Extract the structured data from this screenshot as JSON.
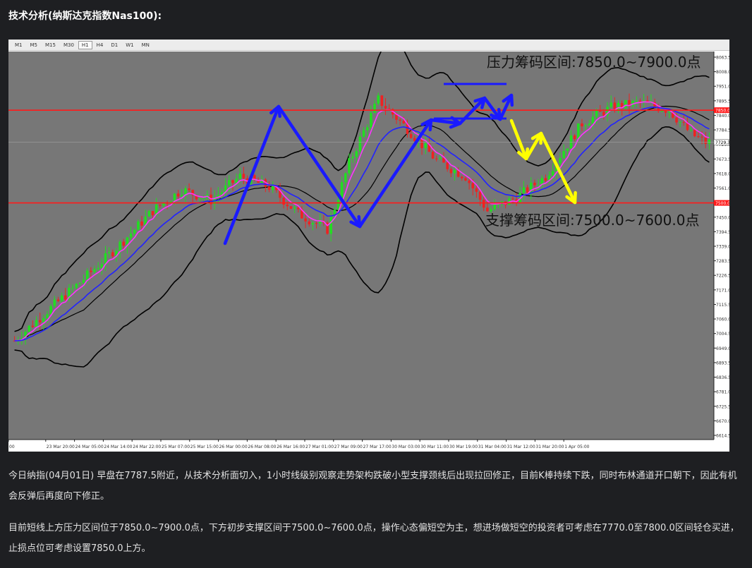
{
  "page": {
    "heading": "技术分析(纳斯达克指数Nas100):",
    "paragraphs": [
      "今日纳指(04月01日) 早盘在7787.5附近，从技术分析面切入，1小时线级别观察走势架构跌破小型支撑颈线后出现拉回修正，目前K棒持续下跌，同时布林通道开口朝下，因此有机会反弹后再度向下修正。",
      "目前短线上方压力区间位于7850.0~7900.0点，下方初步支撑区间于7500.0~7600.0点，操作心态偏短空为主，想进场做短空的投资者可考虑在7770.0至7800.0区间轻仓买进，止损点位可考虑设置7850.0上方。"
    ]
  },
  "toolbar": {
    "timeframes": [
      "M1",
      "M5",
      "M15",
      "M30",
      "H1",
      "H4",
      "D1",
      "W1",
      "MN"
    ],
    "active": "H1"
  },
  "colors": {
    "plot_bg": "#777777",
    "resistance_line": "#ff1a1a",
    "support_line": "#ff1a1a",
    "arrows_blue": "#1a1aff",
    "arrows_yellow": "#ffff00",
    "bull_candle": "#22dd22",
    "bear_candle": "#ee2222",
    "ma_fast": "#ff33ff",
    "ma_slow": "#2222ff",
    "bollinger": "#000000"
  },
  "chart_data": {
    "type": "candlestick",
    "symbol": "Nas100",
    "timeframe": "H1",
    "annotations": {
      "resistance_label": "压力筹码区间:7850.0~7900.0点",
      "support_label": "支撑筹码区间:7500.0~7600.0点"
    },
    "horizontal_lines": [
      {
        "value": 7850.0,
        "label": "7850.0"
      },
      {
        "value": 7500.0,
        "label": "7500.0"
      }
    ],
    "current_price": {
      "value": 7729.3,
      "label": "7729.3"
    },
    "ylim": [
      6614.5,
      8063.5
    ],
    "y_ticks": [
      "8063.5",
      "8008.0",
      "7951.0",
      "7895.5",
      "7840.0",
      "7784.5",
      "7729.0",
      "7673.5",
      "7618.0",
      "7561.0",
      "7505.5",
      "7450.0",
      "7394.5",
      "7339.0",
      "7283.5",
      "7226.5",
      "7171.0",
      "7115.5",
      "7060.0",
      "7004.5",
      "6949.0",
      "6893.5",
      "6836.5",
      "6781.0",
      "6725.5",
      "6670.0",
      "6614.5"
    ],
    "x_ticks": [
      "00",
      "23 Mar 20:00",
      "24 Mar 05:00",
      "24 Mar 14:00",
      "24 Mar 22:00",
      "25 Mar 07:00",
      "25 Mar 15:00",
      "26 Mar 00:00",
      "26 Mar 08:00",
      "26 Mar 16:00",
      "27 Mar 01:00",
      "27 Mar 09:00",
      "27 Mar 17:00",
      "30 Mar 03:00",
      "30 Mar 11:00",
      "30 Mar 19:00",
      "31 Mar 04:00",
      "31 Mar 12:00",
      "31 Mar 20:00",
      "1 Apr 05:00"
    ],
    "path_points": [
      {
        "i": 0,
        "v": 6980
      },
      {
        "i": 8,
        "v": 7080
      },
      {
        "i": 18,
        "v": 7200
      },
      {
        "i": 28,
        "v": 7330
      },
      {
        "i": 38,
        "v": 7470
      },
      {
        "i": 46,
        "v": 7550
      },
      {
        "i": 54,
        "v": 7510
      },
      {
        "i": 62,
        "v": 7600
      },
      {
        "i": 70,
        "v": 7560
      },
      {
        "i": 78,
        "v": 7460
      },
      {
        "i": 86,
        "v": 7400
      },
      {
        "i": 92,
        "v": 7650
      },
      {
        "i": 100,
        "v": 7890
      },
      {
        "i": 108,
        "v": 7780
      },
      {
        "i": 116,
        "v": 7660
      },
      {
        "i": 124,
        "v": 7600
      },
      {
        "i": 130,
        "v": 7470
      },
      {
        "i": 138,
        "v": 7520
      },
      {
        "i": 146,
        "v": 7600
      },
      {
        "i": 156,
        "v": 7800
      },
      {
        "i": 164,
        "v": 7860
      },
      {
        "i": 172,
        "v": 7880
      },
      {
        "i": 180,
        "v": 7850
      },
      {
        "i": 186,
        "v": 7760
      },
      {
        "i": 190,
        "v": 7729
      }
    ],
    "arrows": [
      {
        "color": "blue",
        "from": [
          307,
          272
        ],
        "to": [
          383,
          78
        ]
      },
      {
        "color": "blue",
        "from": [
          383,
          78
        ],
        "to": [
          498,
          248
        ]
      },
      {
        "color": "blue",
        "from": [
          498,
          248
        ],
        "to": [
          599,
          97
        ]
      },
      {
        "color": "blue",
        "from": [
          599,
          97
        ],
        "to": [
          640,
          102
        ]
      },
      {
        "color": "blue",
        "from": [
          640,
          102
        ],
        "to": [
          675,
          66
        ]
      },
      {
        "color": "blue",
        "from": [
          675,
          66
        ],
        "to": [
          697,
          96
        ]
      },
      {
        "color": "blue",
        "from": [
          697,
          96
        ],
        "to": [
          713,
          62
        ]
      },
      {
        "color": "yellow",
        "from": [
          713,
          98
        ],
        "to": [
          734,
          152
        ]
      },
      {
        "color": "yellow",
        "from": [
          734,
          152
        ],
        "to": [
          755,
          116
        ]
      },
      {
        "color": "yellow",
        "from": [
          755,
          116
        ],
        "to": [
          803,
          214
        ]
      }
    ]
  }
}
